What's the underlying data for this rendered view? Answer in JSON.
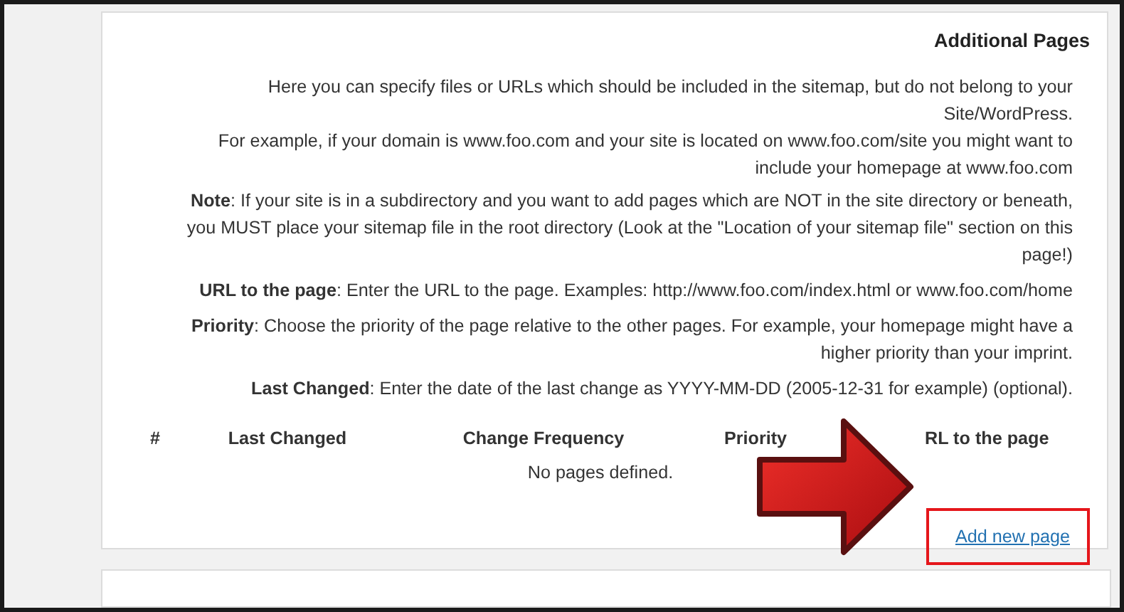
{
  "section": {
    "title": "Additional Pages",
    "intro": [
      "Here you can specify files or URLs which should be included in the sitemap, but do not belong to your Site/WordPress.",
      "For example, if your domain is www.foo.com and your site is located on www.foo.com/site you might want to include your homepage at www.foo.com"
    ],
    "notes": [
      "**Note**: If your site is in a subdirectory and you want to add pages which are NOT in the site directory or beneath, you MUST place your sitemap file in the root directory (Look at the \"Location of your sitemap file\" section on this page!)",
      "**URL to the page**: Enter the URL to the page. Examples: http://www.foo.com/index.html or www.foo.com/home",
      "**Priority**: Choose the priority of the page relative to the other pages. For example, your homepage might have a higher priority than your imprint.",
      "**Last Changed**: Enter the date of the last change as YYYY-MM-DD (2005-12-31 for example) (optional)."
    ]
  },
  "table": {
    "columns": [
      "#",
      "Last Changed",
      "Change Frequency",
      "Priority",
      "RL to the page"
    ],
    "empty_message": "No pages defined."
  },
  "add_link": {
    "label": "Add new page",
    "highlighted": true
  }
}
